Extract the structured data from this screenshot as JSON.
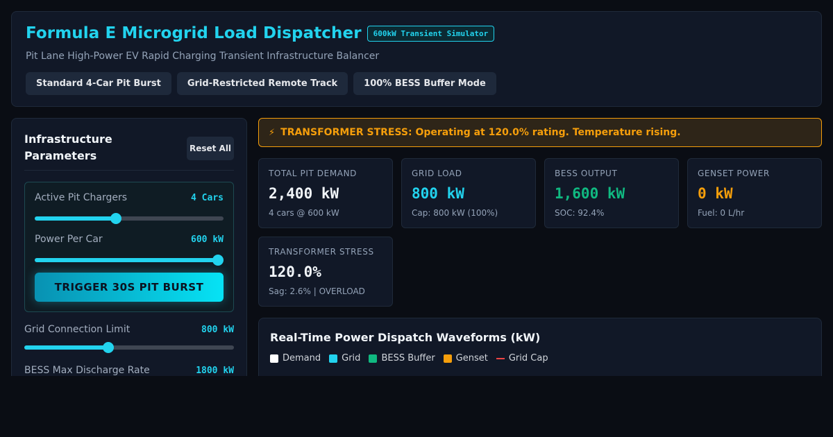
{
  "header": {
    "title": "Formula E Microgrid Load Dispatcher",
    "badge": "600kW Transient Simulator",
    "subtitle": "Pit Lane High-Power EV Rapid Charging Transient Infrastructure Balancer",
    "presets": [
      "Standard 4-Car Pit Burst",
      "Grid-Restricted Remote Track",
      "100% BESS Buffer Mode"
    ]
  },
  "sidebar": {
    "title": "Infrastructure Parameters",
    "reset_label": "Reset All",
    "params": {
      "pit_chargers": {
        "label": "Active Pit Chargers",
        "value": "4 Cars",
        "level": 0.43
      },
      "power_per_car": {
        "label": "Power Per Car",
        "value": "600 kW",
        "level": 1.0
      },
      "grid_limit": {
        "label": "Grid Connection Limit",
        "value": "800 kW",
        "level": 0.4
      },
      "bess_rate": {
        "label": "BESS Max Discharge Rate",
        "value": "1800 kW"
      }
    },
    "trigger_label": "TRIGGER 30S PIT BURST"
  },
  "alert": {
    "icon": "lightning-bolt-icon",
    "glyph": "⚡",
    "text": "TRANSFORMER STRESS: Operating at 120.0% rating. Temperature rising."
  },
  "metrics": [
    {
      "label": "TOTAL PIT DEMAND",
      "value": "2,400 kW",
      "sub": "4 cars @ 600 kW",
      "color": "#f1f5f9"
    },
    {
      "label": "GRID LOAD",
      "value": "800 kW",
      "sub": "Cap: 800 kW (100%)",
      "color": "#22d3ee"
    },
    {
      "label": "BESS OUTPUT",
      "value": "1,600 kW",
      "sub": "SOC: 92.4%",
      "color": "#10b981"
    },
    {
      "label": "GENSET POWER",
      "value": "0 kW",
      "sub": "Fuel: 0 L/hr",
      "color": "#f59e0b"
    },
    {
      "label": "TRANSFORMER STRESS",
      "value": "120.0%",
      "sub": "Sag: 2.6% | OVERLOAD",
      "color": "#f1f5f9"
    }
  ],
  "waveforms": {
    "title": "Real-Time Power Dispatch Waveforms (kW)",
    "legend": [
      {
        "label": "Demand",
        "color": "#ffffff",
        "kind": "box"
      },
      {
        "label": "Grid",
        "color": "#22d3ee",
        "kind": "box"
      },
      {
        "label": "BESS Buffer",
        "color": "#10b981",
        "kind": "box"
      },
      {
        "label": "Genset",
        "color": "#f59e0b",
        "kind": "box"
      },
      {
        "label": "Grid Cap",
        "color": "#ef4444",
        "kind": "line"
      }
    ]
  }
}
